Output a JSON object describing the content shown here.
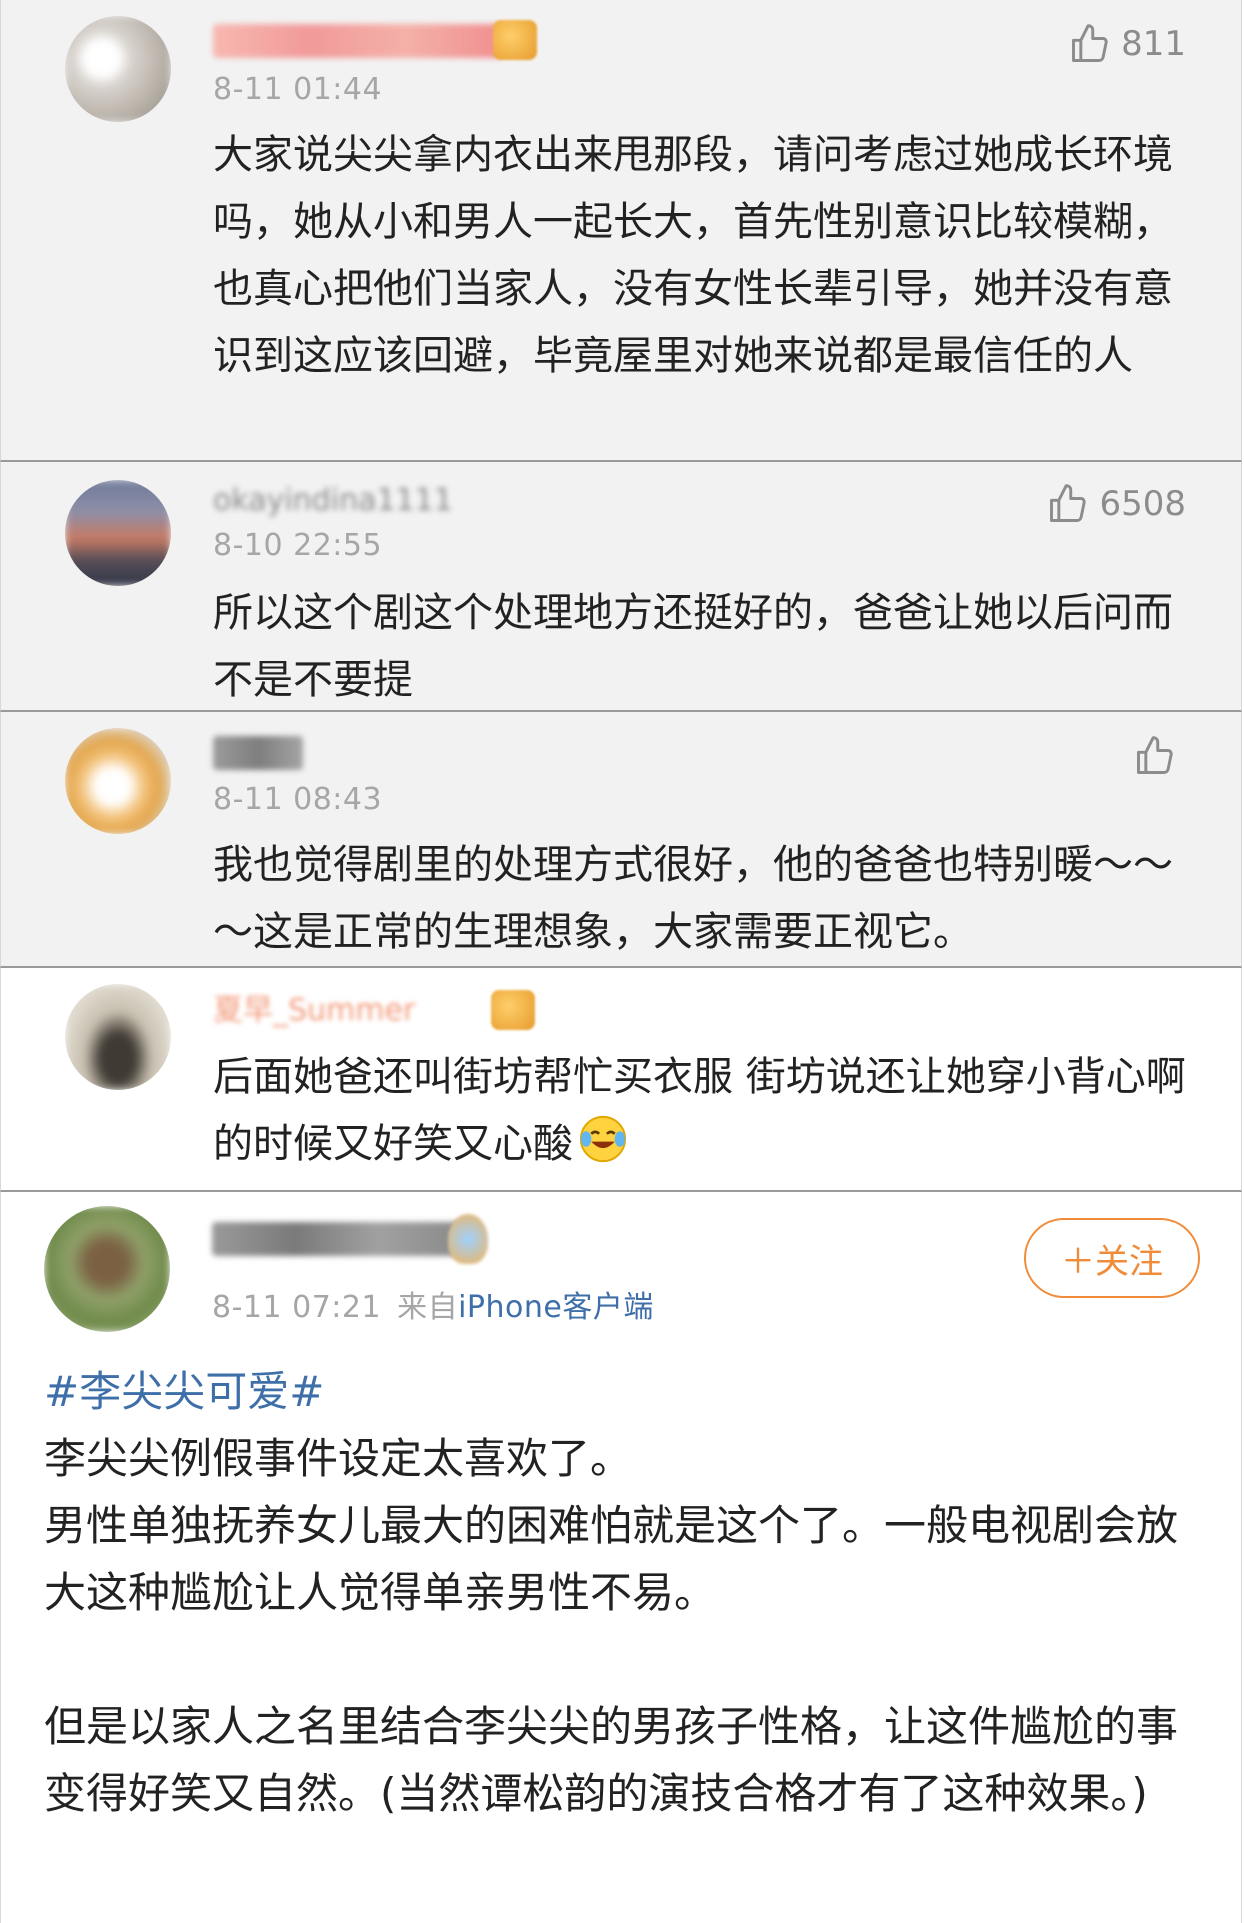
{
  "comments": [
    {
      "time": "8-11 01:44",
      "likes": "811",
      "text": "大家说尖尖拿内衣出来甩那段，请问考虑过她成长环境吗，她从小和男人一起长大，首先性别意识比较模糊，也真心把他们当家人，没有女性长辈引导，她并没有意识到这应该回避，毕竟屋里对她来说都是最信任的人"
    },
    {
      "username": "okayindina1111",
      "time": "8-10 22:55",
      "likes": "6508",
      "text": "所以这个剧这个处理地方还挺好的，爸爸让她以后问而不是不要提"
    },
    {
      "time": "8-11 08:43",
      "likes": "",
      "text": "我也觉得剧里的处理方式很好，他的爸爸也特别暖～～～这是正常的生理想象，大家需要正视它。"
    },
    {
      "username": "夏早_Summer",
      "text": "后面她爸还叫街坊帮忙买衣服 街坊说还让她穿小背心啊的时候又好笑又心酸"
    }
  ],
  "post": {
    "time": "8-11 07:21",
    "source_prefix": "来自",
    "source_link": "iPhone客户端",
    "follow_label": "＋关注",
    "hashtag": "#李尖尖可爱#",
    "paragraph1_line1": "李尖尖例假事件设定太喜欢了。",
    "paragraph1_line2": "男性单独抚养女儿最大的困难怕就是这个了。一般电视剧会放大这种尴尬让人觉得单亲男性不易。",
    "paragraph2": "但是以家人之名里结合李尖尖的男孩子性格，让这件尴尬的事变得好笑又自然。(当然谭松韵的演技合格才有了这种效果。)"
  },
  "colors": {
    "accent_orange": "#f08b3a",
    "link_blue": "#3f6fa8",
    "meta_gray": "#a6a6a6"
  },
  "icons": [
    "thumbs-up-icon",
    "badge-icon",
    "laugh-cry-emoji-icon"
  ]
}
